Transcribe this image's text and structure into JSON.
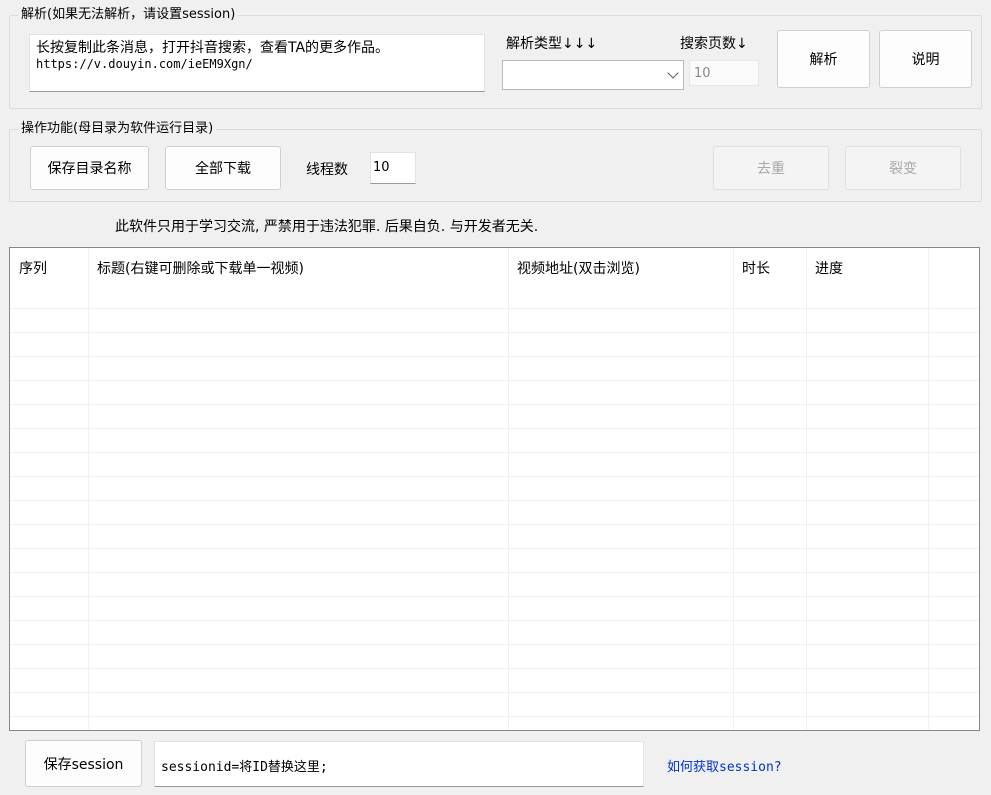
{
  "parse_group": {
    "title": "解析(如果无法解析，请设置session)",
    "message_line1": "长按复制此条消息，打开抖音搜索，查看TA的更多作品。",
    "message_line2": "https://v.douyin.com/ieEM9Xgn/",
    "type_label": "解析类型↓↓↓",
    "type_value": "",
    "pages_label": "搜索页数↓",
    "pages_value": "10",
    "parse_button": "解析",
    "help_button": "说明"
  },
  "ops_group": {
    "title": "操作功能(母目录为软件运行目录)",
    "save_dir_button": "保存目录名称",
    "download_all_button": "全部下载",
    "threads_label": "线程数",
    "threads_value": "10",
    "dedupe_button": "去重",
    "split_button": "裂变"
  },
  "disclaimer": "此软件只用于学习交流, 严禁用于违法犯罪. 后果自负. 与开发者无关.",
  "table": {
    "columns": [
      "序列",
      "标题(右键可删除或下载单一视频)",
      "视频地址(双击浏览)",
      "时长",
      "进度"
    ],
    "rows": []
  },
  "session": {
    "save_button": "保存session",
    "input_value": "sessionid=将ID替换这里;",
    "help_link": "如何获取session?",
    "link_color": "#0033cc"
  }
}
